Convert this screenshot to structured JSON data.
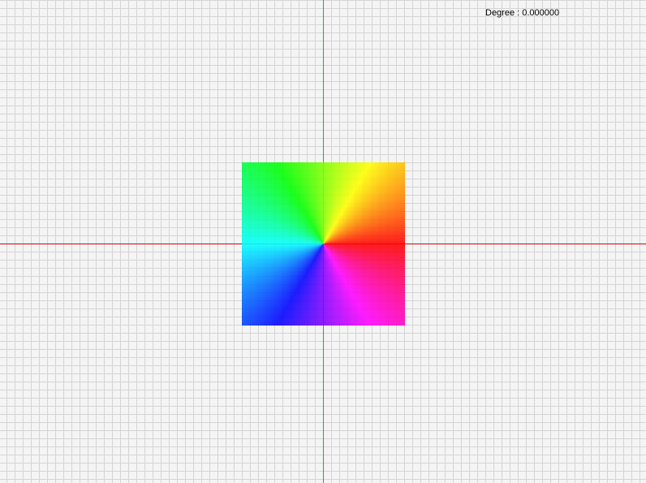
{
  "viewport": {
    "background_color": "#f4f4f4",
    "grid_color": "#d4d4d4",
    "x_axis_color": "#e00000",
    "y_axis_color": "#00cc00"
  },
  "readout": {
    "label": "Degree : ",
    "value": "0.000000"
  },
  "color_wheel": {
    "rotation_degrees": 0,
    "stops": [
      "#ff0000",
      "#ffff00",
      "#00ff00",
      "#00ffff",
      "#0000ff",
      "#ff00ff",
      "#ff0000"
    ],
    "stop_opacity": 0.88
  }
}
